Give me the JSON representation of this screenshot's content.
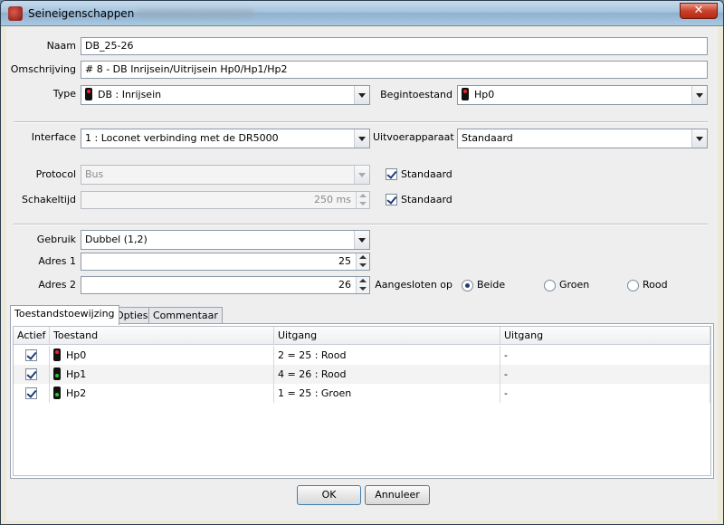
{
  "window": {
    "title": "Seineigenschappen",
    "close_label": "✕"
  },
  "form": {
    "naam": {
      "label": "Naam",
      "value": "DB_25-26"
    },
    "omschrijving": {
      "label": "Omschrijving",
      "value": "# 8 - DB Inrijsein/Uitrijsein Hp0/Hp1/Hp2"
    },
    "type": {
      "label": "Type",
      "value": "DB : Inrijsein"
    },
    "begintoestand": {
      "label": "Begintoestand",
      "value": "Hp0"
    },
    "interface": {
      "label": "Interface",
      "value": "1 : Loconet verbinding met de DR5000"
    },
    "uitvoerapparaat": {
      "label": "Uitvoerapparaat",
      "value": "Standaard"
    },
    "protocol": {
      "label": "Protocol",
      "value": "Bus",
      "standard_label": "Standaard",
      "standard_checked": true
    },
    "schakeltijd": {
      "label": "Schakeltijd",
      "value": "250 ms",
      "standard_label": "Standaard",
      "standard_checked": true
    },
    "gebruik": {
      "label": "Gebruik",
      "value": "Dubbel (1,2)"
    },
    "adres1": {
      "label": "Adres 1",
      "value": "25"
    },
    "adres2": {
      "label": "Adres 2",
      "value": "26"
    },
    "aangesloten": {
      "label": "Aangesloten op",
      "options": [
        "Beide",
        "Groen",
        "Rood"
      ],
      "selected": "Beide"
    }
  },
  "tabs": [
    {
      "label": "Toestandstoewijzing",
      "active": true
    },
    {
      "label": "Opties",
      "active": false
    },
    {
      "label": "Commentaar",
      "active": false
    }
  ],
  "table": {
    "columns": [
      "Actief",
      "Toestand",
      "Uitgang",
      "Uitgang"
    ],
    "rows": [
      {
        "actief": true,
        "toestand": "Hp0",
        "icon": "red",
        "uitgang1": "2 = 25 : Rood",
        "uitgang2": "-"
      },
      {
        "actief": true,
        "toestand": "Hp1",
        "icon": "green",
        "uitgang1": "4 = 26 : Rood",
        "uitgang2": "-"
      },
      {
        "actief": true,
        "toestand": "Hp2",
        "icon": "green",
        "uitgang1": "1 = 25 : Groen",
        "uitgang2": "-"
      }
    ]
  },
  "buttons": {
    "ok": "OK",
    "cancel": "Annuleer"
  },
  "icons": {
    "app": "signal-app-icon",
    "signal": "signal-icon",
    "close": "close-icon"
  }
}
